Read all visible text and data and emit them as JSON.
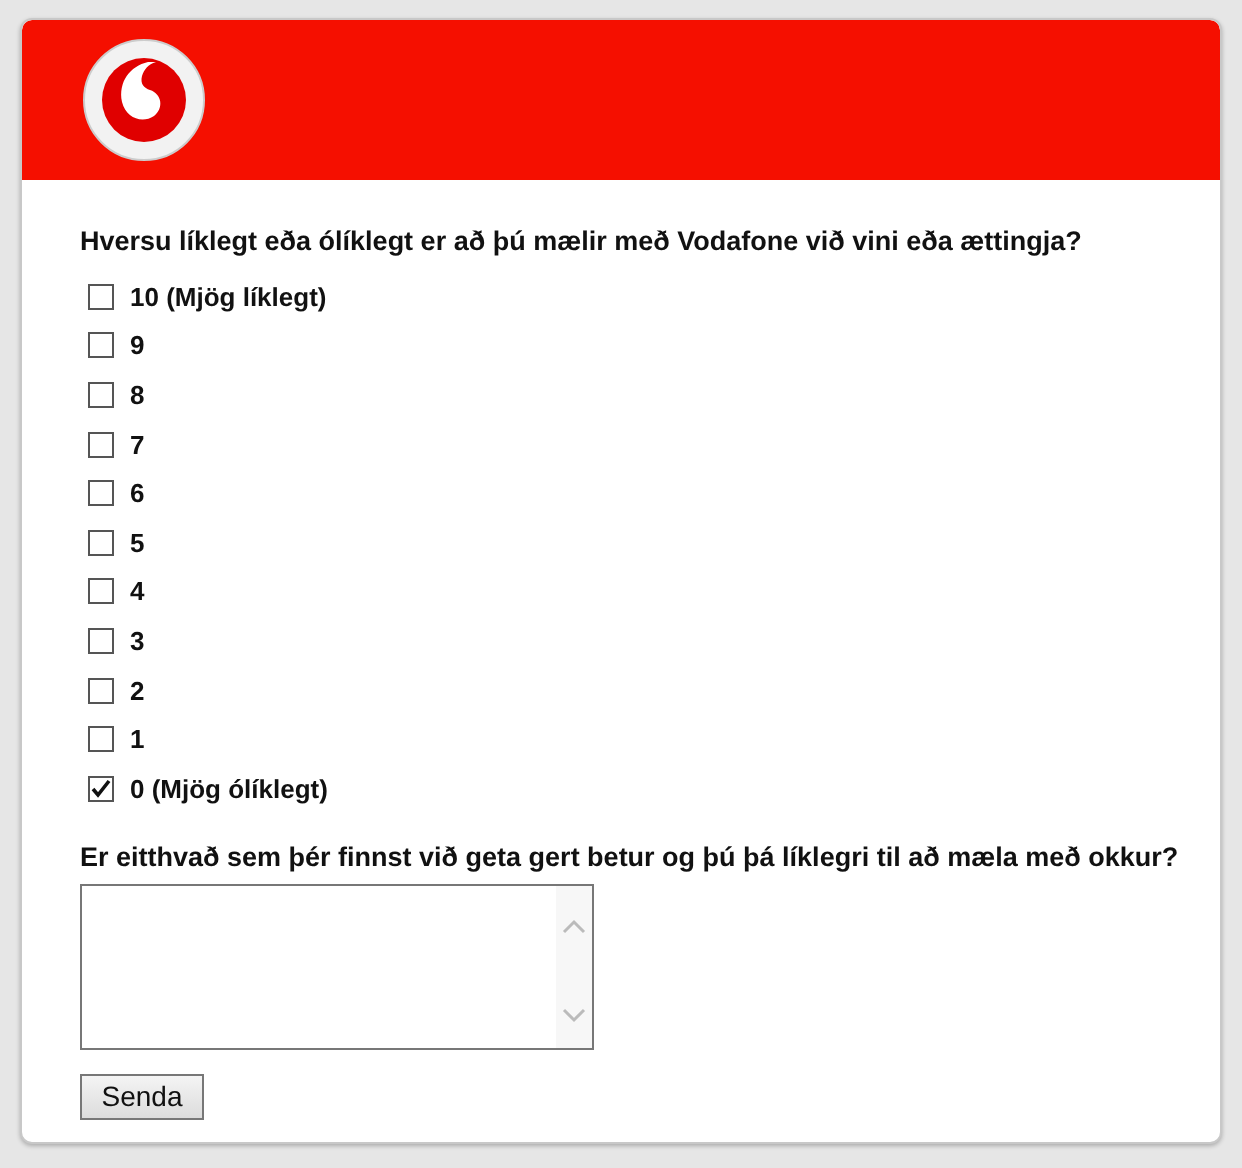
{
  "question": "Hversu líklegt eða ólíklegt er að þú mælir með Vodafone við vini eða ættingja?",
  "options": [
    {
      "label": "10 (Mjög líklegt)",
      "checked": false
    },
    {
      "label": "9",
      "checked": false
    },
    {
      "label": "8",
      "checked": false
    },
    {
      "label": "7",
      "checked": false
    },
    {
      "label": "6",
      "checked": false
    },
    {
      "label": "5",
      "checked": false
    },
    {
      "label": "4",
      "checked": false
    },
    {
      "label": "3",
      "checked": false
    },
    {
      "label": "2",
      "checked": false
    },
    {
      "label": "1",
      "checked": false
    },
    {
      "label": "0 (Mjög ólíklegt)",
      "checked": true
    }
  ],
  "comment_question": "Er eitthvað sem þér finnst við geta gert betur og þú þá líklegri til að mæla með okkur?",
  "submit": "Senda"
}
